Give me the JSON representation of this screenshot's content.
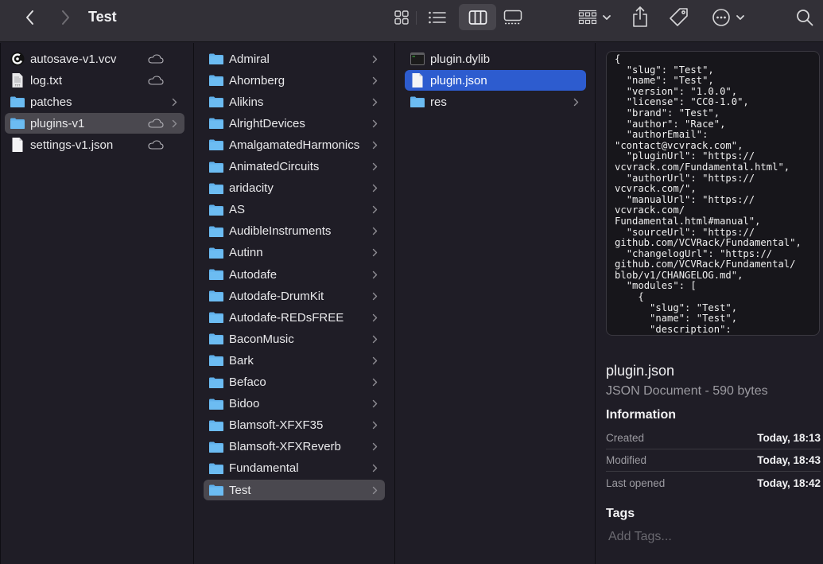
{
  "window": {
    "title": "Test",
    "toolbar": {
      "back": "back-icon",
      "forward": "forward-icon",
      "views": [
        {
          "name": "icon-view",
          "active": false
        },
        {
          "name": "list-view",
          "active": false
        },
        {
          "name": "column-view",
          "active": true
        },
        {
          "name": "gallery-view",
          "active": false
        }
      ],
      "group": "group-icon",
      "share": "share-icon",
      "tags": "tag-icon",
      "more": "more-icon",
      "search": "search-icon"
    }
  },
  "columns": [
    {
      "items": [
        {
          "label": "autosave-v1.vcv",
          "icon": "vcv-file",
          "cloud": true,
          "chevron": false,
          "selected": ""
        },
        {
          "label": "log.txt",
          "icon": "text-file",
          "cloud": true,
          "chevron": false,
          "selected": ""
        },
        {
          "label": "patches",
          "icon": "folder",
          "cloud": false,
          "chevron": true,
          "selected": ""
        },
        {
          "label": "plugins-v1",
          "icon": "folder",
          "cloud": true,
          "chevron": true,
          "selected": "gray"
        },
        {
          "label": "settings-v1.json",
          "icon": "document",
          "cloud": true,
          "chevron": false,
          "selected": ""
        }
      ]
    },
    {
      "items": [
        {
          "label": "Admiral",
          "icon": "folder",
          "chevron": true,
          "selected": ""
        },
        {
          "label": "Ahornberg",
          "icon": "folder",
          "chevron": true,
          "selected": ""
        },
        {
          "label": "Alikins",
          "icon": "folder",
          "chevron": true,
          "selected": ""
        },
        {
          "label": "AlrightDevices",
          "icon": "folder",
          "chevron": true,
          "selected": ""
        },
        {
          "label": "AmalgamatedHarmonics",
          "icon": "folder",
          "chevron": true,
          "selected": ""
        },
        {
          "label": "AnimatedCircuits",
          "icon": "folder",
          "chevron": true,
          "selected": ""
        },
        {
          "label": "aridacity",
          "icon": "folder",
          "chevron": true,
          "selected": ""
        },
        {
          "label": "AS",
          "icon": "folder",
          "chevron": true,
          "selected": ""
        },
        {
          "label": "AudibleInstruments",
          "icon": "folder",
          "chevron": true,
          "selected": ""
        },
        {
          "label": "Autinn",
          "icon": "folder",
          "chevron": true,
          "selected": ""
        },
        {
          "label": "Autodafe",
          "icon": "folder",
          "chevron": true,
          "selected": ""
        },
        {
          "label": "Autodafe-DrumKit",
          "icon": "folder",
          "chevron": true,
          "selected": ""
        },
        {
          "label": "Autodafe-REDsFREE",
          "icon": "folder",
          "chevron": true,
          "selected": ""
        },
        {
          "label": "BaconMusic",
          "icon": "folder",
          "chevron": true,
          "selected": ""
        },
        {
          "label": "Bark",
          "icon": "folder",
          "chevron": true,
          "selected": ""
        },
        {
          "label": "Befaco",
          "icon": "folder",
          "chevron": true,
          "selected": ""
        },
        {
          "label": "Bidoo",
          "icon": "folder",
          "chevron": true,
          "selected": ""
        },
        {
          "label": "Blamsoft-XFXF35",
          "icon": "folder",
          "chevron": true,
          "selected": ""
        },
        {
          "label": "Blamsoft-XFXReverb",
          "icon": "folder",
          "chevron": true,
          "selected": ""
        },
        {
          "label": "Fundamental",
          "icon": "folder",
          "chevron": true,
          "selected": ""
        },
        {
          "label": "Test",
          "icon": "folder",
          "chevron": true,
          "selected": "gray"
        }
      ]
    },
    {
      "items": [
        {
          "label": "plugin.dylib",
          "icon": "executable",
          "chevron": false,
          "selected": ""
        },
        {
          "label": "plugin.json",
          "icon": "document",
          "chevron": false,
          "selected": "blue"
        },
        {
          "label": "res",
          "icon": "folder",
          "chevron": true,
          "selected": ""
        }
      ]
    }
  ],
  "preview": {
    "code": "{\n  \"slug\": \"Test\",\n  \"name\": \"Test\",\n  \"version\": \"1.0.0\",\n  \"license\": \"CC0-1.0\",\n  \"brand\": \"Test\",\n  \"author\": \"Race\",\n  \"authorEmail\":\n\"contact@vcvrack.com\",\n  \"pluginUrl\": \"https://\nvcvrack.com/Fundamental.html\",\n  \"authorUrl\": \"https://\nvcvrack.com/\",\n  \"manualUrl\": \"https://\nvcvrack.com/\nFundamental.html#manual\",\n  \"sourceUrl\": \"https://\ngithub.com/VCVRack/Fundamental\",\n  \"changelogUrl\": \"https://\ngithub.com/VCVRack/Fundamental/\nblob/v1/CHANGELOG.md\",\n  \"modules\": [\n    {\n      \"slug\": \"Test\",\n      \"name\": \"Test\",\n      \"description\":",
    "file_name": "plugin.json",
    "file_kind": "JSON Document - 590 bytes",
    "info_heading": "Information",
    "info": [
      {
        "key": "Created",
        "value": "Today, 18:13"
      },
      {
        "key": "Modified",
        "value": "Today, 18:43"
      },
      {
        "key": "Last opened",
        "value": "Today, 18:42"
      }
    ],
    "tags_heading": "Tags",
    "tags_placeholder": "Add Tags..."
  },
  "colors": {
    "folder": "#5fb0eb",
    "selection_blue": "#2d5ccf",
    "selection_gray": "#4a484f"
  }
}
